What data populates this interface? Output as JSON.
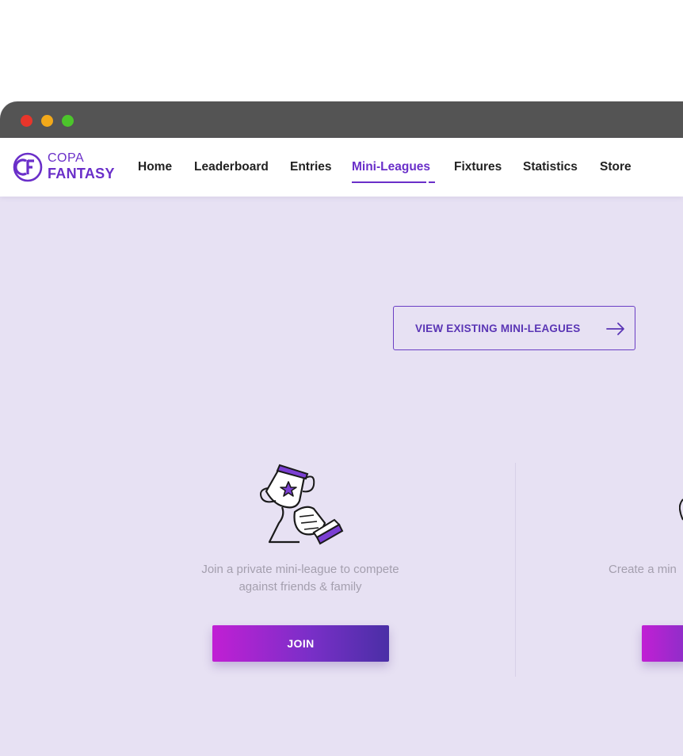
{
  "brand": {
    "name_top": "COPA",
    "name_bottom": "FANTASY",
    "accent_color": "#6a2fc9"
  },
  "nav": {
    "items": [
      {
        "label": "Home",
        "active": false
      },
      {
        "label": "Leaderboard",
        "active": false
      },
      {
        "label": "Entries",
        "active": false
      },
      {
        "label": "Mini-Leagues",
        "active": true
      },
      {
        "label": "Fixtures",
        "active": false
      },
      {
        "label": "Statistics",
        "active": false
      },
      {
        "label": "Store",
        "active": false
      }
    ]
  },
  "main": {
    "view_existing_label": "VIEW EXISTING MINI-LEAGUES",
    "join": {
      "description_line1": "Join a private mini-league to compete",
      "description_line2": "against friends & family",
      "button_label": "JOIN",
      "icon": "trophy-icon"
    },
    "create": {
      "description_partial": "Create a min",
      "button_gradient_start": "#c11fd4"
    }
  },
  "window": {
    "traffic_lights": [
      "#e8352b",
      "#f2a91a",
      "#4cc52b"
    ]
  }
}
